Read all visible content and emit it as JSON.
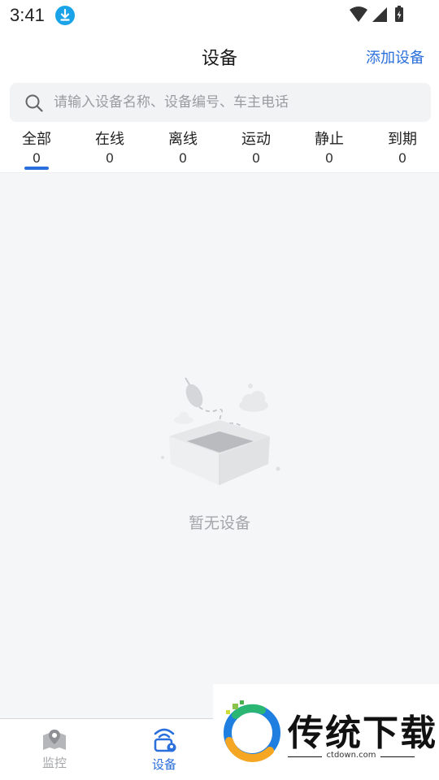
{
  "status_bar": {
    "time": "3:41"
  },
  "header": {
    "title": "设备",
    "action_label": "添加设备"
  },
  "search": {
    "placeholder": "请输入设备名称、设备编号、车主电话",
    "value": ""
  },
  "tabs": [
    {
      "label": "全部",
      "count": "0"
    },
    {
      "label": "在线",
      "count": "0"
    },
    {
      "label": "离线",
      "count": "0"
    },
    {
      "label": "运动",
      "count": "0"
    },
    {
      "label": "静止",
      "count": "0"
    },
    {
      "label": "到期",
      "count": "0"
    }
  ],
  "active_tab": 0,
  "empty_state": {
    "message": "暂无设备"
  },
  "bottom_nav": [
    {
      "label": "监控",
      "icon": "map-pin-icon",
      "active": false
    },
    {
      "label": "设备",
      "icon": "device-icon",
      "active": true
    }
  ],
  "watermark": {
    "text": "传统下载",
    "url": "ctdown.com"
  },
  "colors": {
    "accent": "#2a6fdb",
    "muted": "#a3a5a8",
    "content_bg": "#f5f6f8",
    "search_bg": "#f2f3f5",
    "download_badge": "#1aa3e8"
  }
}
